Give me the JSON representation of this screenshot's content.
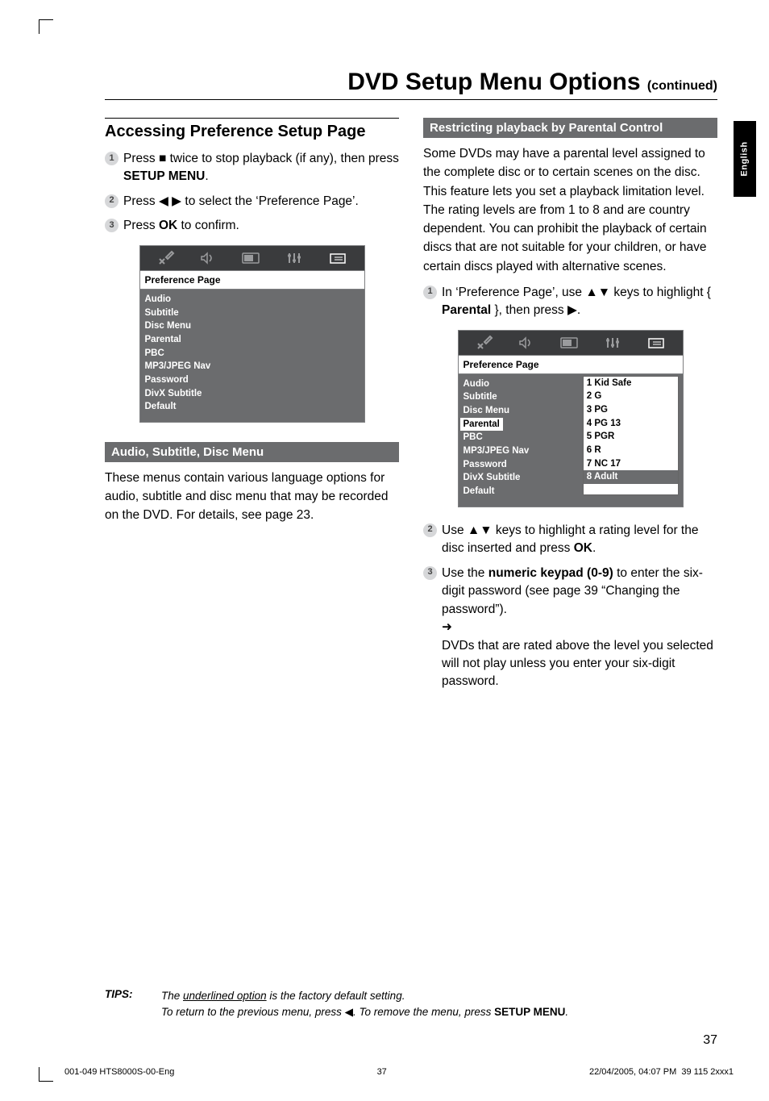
{
  "page": {
    "title_main": "DVD Setup Menu Options",
    "title_suffix": "(continued)",
    "lang_tab": "English",
    "page_number": "37"
  },
  "left": {
    "heading": "Accessing Preference Setup Page",
    "steps": [
      {
        "n": "1",
        "pre": "Press ",
        "glyph": "■",
        "mid": "  twice to stop playback (if any), then press ",
        "bold": "SETUP MENU",
        "post": "."
      },
      {
        "n": "2",
        "pre": "Press ",
        "glyph": "◀ ▶",
        "mid": " to select the ‘Preference Page’."
      },
      {
        "n": "3",
        "pre": "Press ",
        "bold": "OK",
        "post": " to confirm."
      }
    ],
    "menu1": {
      "header": "Preference Page",
      "items": [
        "Audio",
        "Subtitle",
        "Disc Menu",
        "Parental",
        "PBC",
        "MP3/JPEG Nav",
        "Password",
        "DivX Subtitle",
        "Default"
      ]
    },
    "band": "Audio, Subtitle, Disc Menu",
    "band_para": "These menus contain various language options for audio, subtitle and disc menu that may be recorded on the DVD.  For details, see page 23."
  },
  "right": {
    "band": "Restricting playback by Parental Control",
    "intro": "Some DVDs may have a parental level assigned to the complete disc or to certain scenes on the disc.  This feature lets you set a playback limitation level. The rating levels are from 1 to 8 and are country dependent.  You can prohibit the playback of certain discs that are not suitable for your children, or have certain discs played with alternative scenes.",
    "step1_pre": "In ‘Preference Page’, use ",
    "step1_glyph": "▲▼",
    "step1_mid": " keys to highlight { ",
    "step1_bold": "Parental",
    "step1_post": " }, then press ",
    "step1_glyph2": "▶",
    "step1_end": ".",
    "menu2": {
      "header": "Preference Page",
      "left_items": [
        "Audio",
        "Subtitle",
        "Disc Menu",
        "Parental",
        "PBC",
        "MP3/JPEG Nav",
        "Password",
        "DivX Subtitle",
        "Default"
      ],
      "highlight": "Parental",
      "right_items": [
        "1  Kid Safe",
        "2  G",
        "3  PG",
        "4  PG 13",
        "5  PGR",
        "6  R",
        "7  NC 17",
        "8  Adult"
      ],
      "selected_right": "8  Adult"
    },
    "step2_pre": "Use ",
    "step2_glyph": "▲▼",
    "step2_mid": " keys to highlight a rating level for the disc inserted and press ",
    "step2_bold": "OK",
    "step2_post": ".",
    "step3_pre": "Use the ",
    "step3_bold": "numeric keypad (0-9)",
    "step3_mid": " to enter the six-digit password (see page 39 “Changing the password”).",
    "step3_arrow": "➜",
    "step3_result": " DVDs that are rated above the level you selected will not play unless you enter your six-digit password."
  },
  "tips": {
    "label": "TIPS:",
    "line1_pre": "The ",
    "line1_ul": "underlined option",
    "line1_post": " is the factory default setting.",
    "line2_pre": "To return to the previous menu, press ",
    "line2_glyph": "◀",
    "line2_mid": ".  To remove the menu, press ",
    "line2_bold": "SETUP MENU",
    "line2_post": "."
  },
  "footer": {
    "left": "001-049 HTS8000S-00-Eng",
    "center": "37",
    "right_a": "22/04/2005, 04:07 PM",
    "right_b": "39 115 2xxx1"
  },
  "icons": {
    "tab1": "wrench-x-icon",
    "tab2": "speaker-icon",
    "tab3": "tv-icon",
    "tab4": "sliders-icon",
    "tab5": "lock-icon"
  }
}
